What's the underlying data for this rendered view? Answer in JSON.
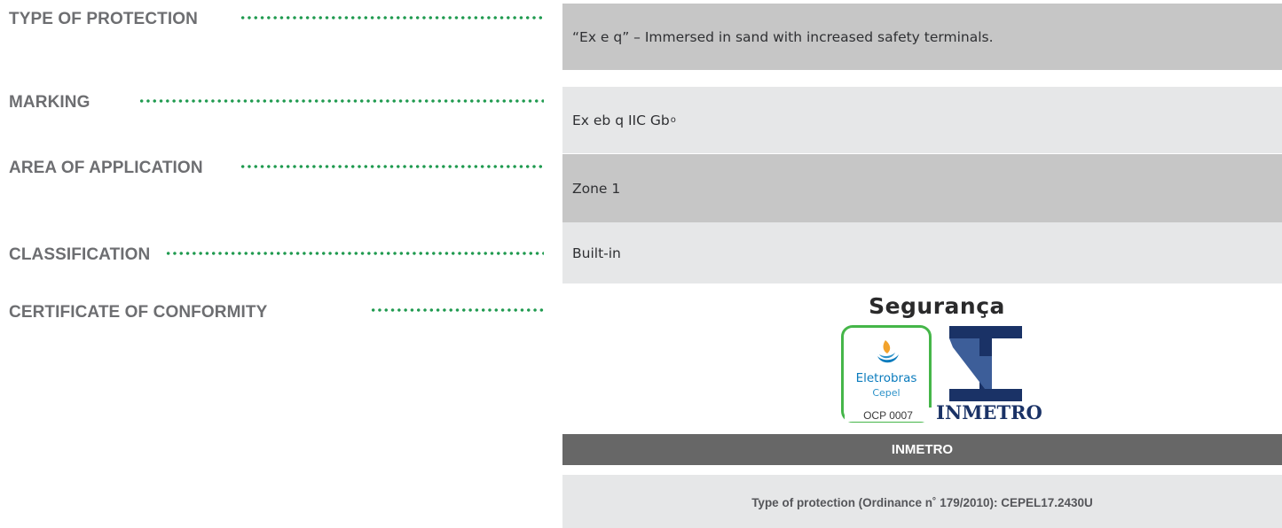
{
  "rows": [
    {
      "label": "TYPE OF PROTECTION",
      "value": "“Ex e q” – Immersed in sand with increased safety terminals."
    },
    {
      "label": "MARKING",
      "value": "Ex eb q IIC Gb",
      "value_subscript": "o"
    },
    {
      "label": "AREA OF APPLICATION",
      "value": "Zone 1"
    },
    {
      "label": "CLASSIFICATION",
      "value": "Built-in"
    },
    {
      "label": "CERTIFICATE OF CONFORMITY"
    }
  ],
  "certificate": {
    "seal_title": "Segurança",
    "eletrobras_name": "Eletrobras",
    "eletrobras_sub": "Cepel",
    "ocp_code": "OCP 0007",
    "inmetro_logo": "INMETRO",
    "header": "INMETRO",
    "detail": "Type of protection (Ordinance n˚ 179/2010): CEPEL17.2430U"
  },
  "colors": {
    "dot_leader": "#1f9a4f",
    "eletrobras_green": "#45b649",
    "eletrobras_blue": "#0a7bbd",
    "inmetro_navy": "#1a3266"
  },
  "icons": [
    "eletrobras-logo-icon",
    "inmetro-logo-icon"
  ]
}
